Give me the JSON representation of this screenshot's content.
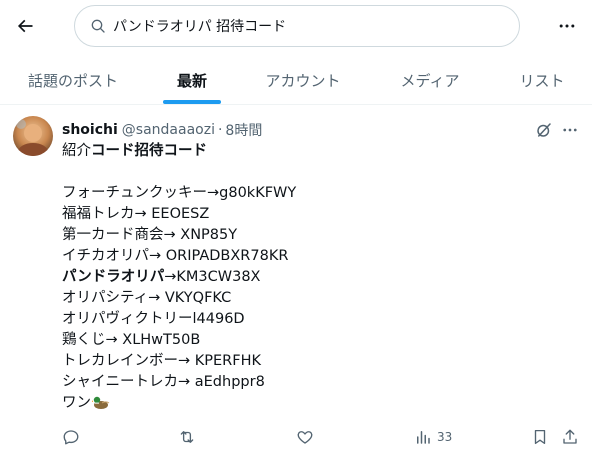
{
  "search": {
    "query": "パンドラオリパ 招待コード"
  },
  "tabs": [
    {
      "label": "話題のポスト"
    },
    {
      "label": "最新"
    },
    {
      "label": "アカウント"
    },
    {
      "label": "メディア"
    },
    {
      "label": "リスト"
    }
  ],
  "active_tab": "最新",
  "post": {
    "author_name": "shoichi",
    "author_handle": "@sandaaaozi",
    "separator": "·",
    "time": "8時間",
    "lines": [
      {
        "pre": "紹介",
        "bold": "コード招待コード",
        "post": ""
      },
      {
        "pre": "",
        "bold": "",
        "post": ""
      },
      {
        "pre": "フォーチュンクッキー→g80kKFWY",
        "bold": "",
        "post": ""
      },
      {
        "pre": "福福トレカ→ EEOESZ",
        "bold": "",
        "post": ""
      },
      {
        "pre": "第一カード商会→ XNP85Y",
        "bold": "",
        "post": ""
      },
      {
        "pre": "イチカオリパ→ ORIPADBXR78KR",
        "bold": "",
        "post": ""
      },
      {
        "pre": "",
        "bold": "パンドラオリパ",
        "post": "→KM3CW38X"
      },
      {
        "pre": "オリパシティ→ VKYQFKC",
        "bold": "",
        "post": ""
      },
      {
        "pre": "オリパヴィクトリーl4496D",
        "bold": "",
        "post": ""
      },
      {
        "pre": "鶏くじ→ XLHwT50B",
        "bold": "",
        "post": ""
      },
      {
        "pre": "トレカレインボー→ KPERFHK",
        "bold": "",
        "post": ""
      },
      {
        "pre": "シャイニートレカ→ aEdhppr8",
        "bold": "",
        "post": ""
      },
      {
        "pre": "ワン",
        "bold": "",
        "post": ""
      }
    ],
    "views_count": "33"
  },
  "colors": {
    "accent": "#1d9bf0",
    "text": "#0f1419",
    "muted": "#536471",
    "border": "#eff3f4"
  },
  "icons": [
    "back-arrow-icon",
    "search-icon",
    "more-icon",
    "grok-icon",
    "duck-emoji-icon",
    "reply-icon",
    "repost-icon",
    "like-icon",
    "views-icon",
    "bookmark-icon",
    "share-icon"
  ]
}
